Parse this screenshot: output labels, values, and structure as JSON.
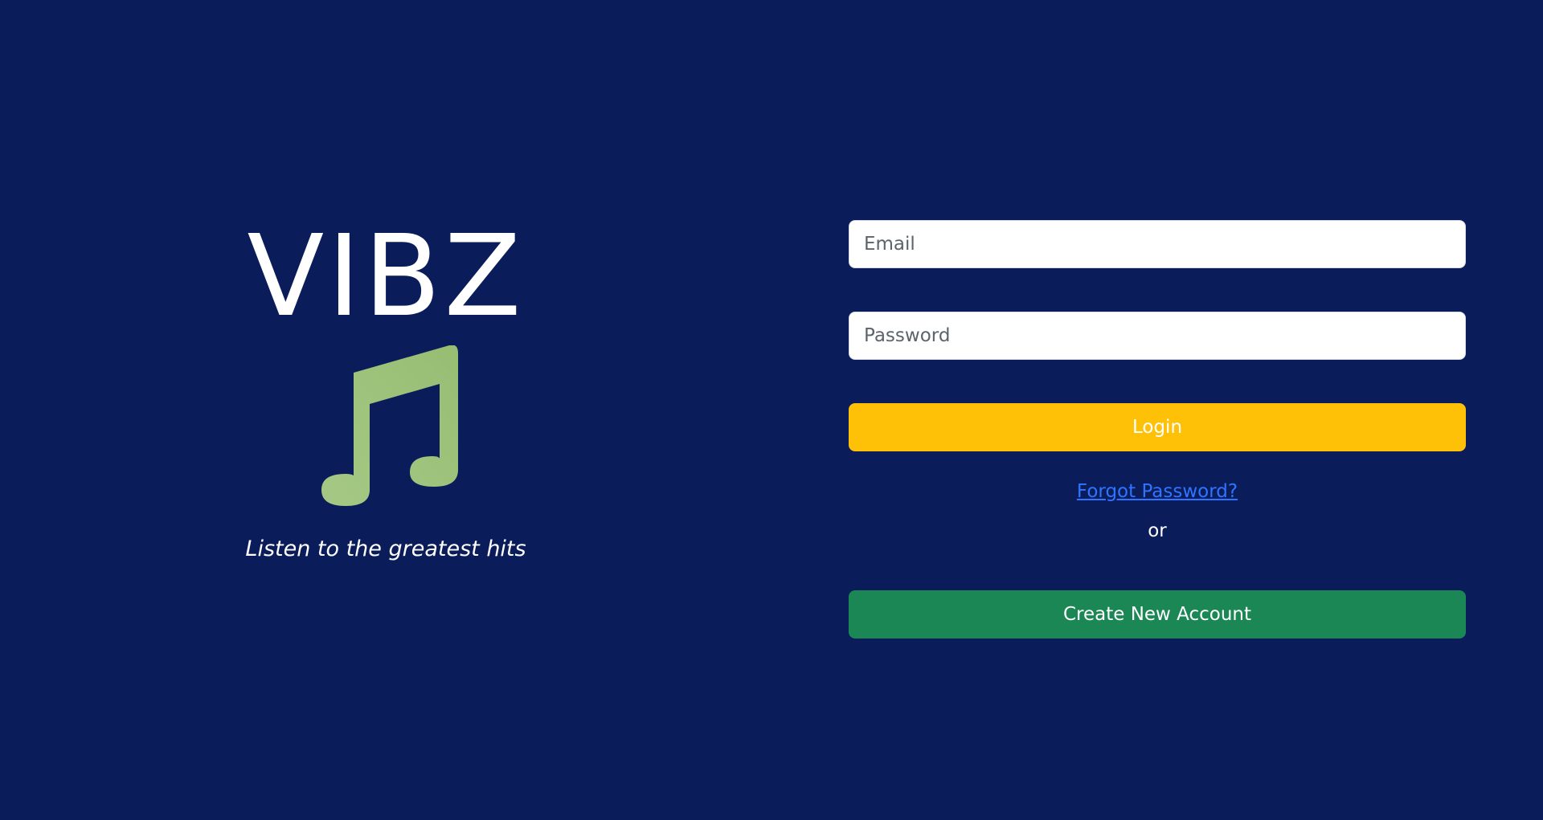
{
  "brand": {
    "title": "VIBZ",
    "icon": "music-note-icon",
    "tagline": "Listen to the greatest hits"
  },
  "login_form": {
    "email_placeholder": "Email",
    "password_placeholder": "Password",
    "login_label": "Login",
    "forgot_password_label": "Forgot Password?",
    "or_label": "or",
    "create_account_label": "Create New Account"
  },
  "colors": {
    "background": "#0a1d5a",
    "icon": "#9dc27a",
    "login_button": "#ffc107",
    "create_button": "#1b8754",
    "link": "#2f74ff"
  }
}
